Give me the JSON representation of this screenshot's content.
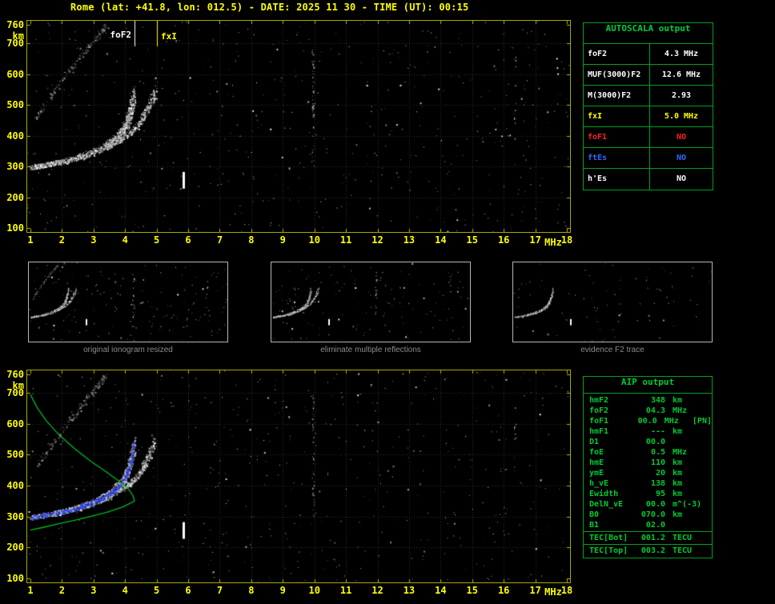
{
  "title": "Rome (lat: +41.8, lon: 012.5) - DATE: 2025 11 30 - TIME (UT): 00:15",
  "units": {
    "x": "MHz",
    "y": "km"
  },
  "markers": {
    "foF2_label": "foF2",
    "fxI_label": "fxI"
  },
  "autoscala_table": {
    "title": "AUTOSCALA output",
    "rows": [
      {
        "label": "foF2",
        "value": "4.3 MHz",
        "color": "#ffffff"
      },
      {
        "label": "MUF(3000)F2",
        "value": "12.6 MHz",
        "color": "#ffffff"
      },
      {
        "label": "M(3000)F2",
        "value": "2.93",
        "color": "#ffffff"
      },
      {
        "label": "fxI",
        "value": "5.0 MHz",
        "color": "#ffff00"
      },
      {
        "label": "foF1",
        "value": "NO",
        "color": "#ff2020"
      },
      {
        "label": "ftEs",
        "value": "NO",
        "color": "#2b6bff"
      },
      {
        "label": "h'Es",
        "value": "NO",
        "color": "#ffffff"
      }
    ]
  },
  "thumbnails": [
    {
      "caption": "original ionogram resized"
    },
    {
      "caption": "eliminate multiple reflections"
    },
    {
      "caption": "evidence F2 trace"
    }
  ],
  "aip_table": {
    "title": "AIP output",
    "rows": [
      {
        "label": "hmF2",
        "value": "348",
        "unit": "km",
        "note": ""
      },
      {
        "label": "foF2",
        "value": "04.3",
        "unit": "MHz",
        "note": ""
      },
      {
        "label": "foF1",
        "value": "00.0",
        "unit": "MHz",
        "note": "[PN]"
      },
      {
        "label": "hmF1",
        "value": "---",
        "unit": "km",
        "note": ""
      },
      {
        "label": "D1",
        "value": "00.0",
        "unit": "",
        "note": ""
      },
      {
        "label": "foE",
        "value": "0.5",
        "unit": "MHz",
        "note": ""
      },
      {
        "label": "hmE",
        "value": "110",
        "unit": "km",
        "note": ""
      },
      {
        "label": "ymE",
        "value": "20",
        "unit": "km",
        "note": ""
      },
      {
        "label": "h_vE",
        "value": "138",
        "unit": "km",
        "note": ""
      },
      {
        "label": "Ewidth",
        "value": "95",
        "unit": "km",
        "note": ""
      },
      {
        "label": "DelN_vE",
        "value": "00.0",
        "unit": "m^(-3)",
        "note": ""
      },
      {
        "label": "B0",
        "value": "070.0",
        "unit": "km",
        "note": ""
      },
      {
        "label": "B1",
        "value": "02.0",
        "unit": "",
        "note": ""
      }
    ],
    "tec_rows": [
      {
        "label": "TEC[Bot]",
        "value": "001.2",
        "unit": "TECU"
      },
      {
        "label": "TEC[Top]",
        "value": "003.2",
        "unit": "TECU"
      }
    ]
  },
  "chart_data": {
    "type": "scatter",
    "x_label": "MHz",
    "y_label": "km",
    "x_range": [
      1,
      18
    ],
    "y_range": [
      100,
      760
    ],
    "x_ticks": [
      1,
      2,
      3,
      4,
      5,
      6,
      7,
      8,
      9,
      10,
      11,
      12,
      13,
      14,
      15,
      16,
      17,
      18
    ],
    "y_ticks": [
      100,
      200,
      300,
      400,
      500,
      600,
      700,
      760
    ],
    "grid": true,
    "foF2_MHz": 4.3,
    "fxI_MHz": 5.0,
    "MUF3000F2_MHz": 12.6,
    "M3000F2": 2.93,
    "hmF2_km": 348,
    "traces": {
      "f2_ordinary": {
        "color": "#ffffff",
        "points": [
          [
            1.0,
            298
          ],
          [
            1.3,
            303
          ],
          [
            1.6,
            308
          ],
          [
            1.9,
            314
          ],
          [
            2.2,
            321
          ],
          [
            2.5,
            330
          ],
          [
            2.8,
            340
          ],
          [
            3.1,
            352
          ],
          [
            3.4,
            367
          ],
          [
            3.6,
            382
          ],
          [
            3.8,
            400
          ],
          [
            3.95,
            420
          ],
          [
            4.05,
            442
          ],
          [
            4.15,
            470
          ],
          [
            4.22,
            502
          ],
          [
            4.28,
            538
          ]
        ]
      },
      "f2_extraordinary": {
        "color": "#e6e6e6",
        "points": [
          [
            3.3,
            358
          ],
          [
            3.7,
            378
          ],
          [
            4.0,
            398
          ],
          [
            4.3,
            422
          ],
          [
            4.5,
            448
          ],
          [
            4.65,
            478
          ],
          [
            4.8,
            508
          ],
          [
            4.95,
            545
          ]
        ]
      },
      "multiple_reflection": {
        "color": "#cfcfcf",
        "points": [
          [
            1.15,
            455
          ],
          [
            1.5,
            510
          ],
          [
            1.9,
            565
          ],
          [
            2.3,
            620
          ],
          [
            2.7,
            672
          ],
          [
            3.0,
            710
          ],
          [
            3.25,
            740
          ],
          [
            3.4,
            758
          ]
        ]
      },
      "restored_f2_blue": {
        "color": "#3a52ff"
      },
      "profile_green": {
        "color": "#00bb22",
        "topside": [
          [
            1.0,
            695
          ],
          [
            1.2,
            655
          ],
          [
            1.5,
            610
          ],
          [
            1.9,
            565
          ],
          [
            2.4,
            520
          ],
          [
            2.9,
            480
          ],
          [
            3.4,
            445
          ],
          [
            3.8,
            415
          ],
          [
            4.1,
            390
          ],
          [
            4.25,
            368
          ],
          [
            4.3,
            350
          ]
        ],
        "bottomside": [
          [
            4.3,
            350
          ],
          [
            3.9,
            330
          ],
          [
            3.4,
            313
          ],
          [
            2.9,
            300
          ],
          [
            2.4,
            288
          ],
          [
            1.9,
            277
          ],
          [
            1.4,
            265
          ],
          [
            1.0,
            256
          ]
        ]
      },
      "rfi_lines": [
        {
          "f": 9.95,
          "h0": 300,
          "h1": 700,
          "count": 48
        },
        {
          "f": 16.35,
          "h0": 430,
          "h1": 660,
          "count": 14
        }
      ],
      "es_bar": {
        "f": 5.85,
        "h0": 228,
        "h1": 282
      }
    }
  }
}
